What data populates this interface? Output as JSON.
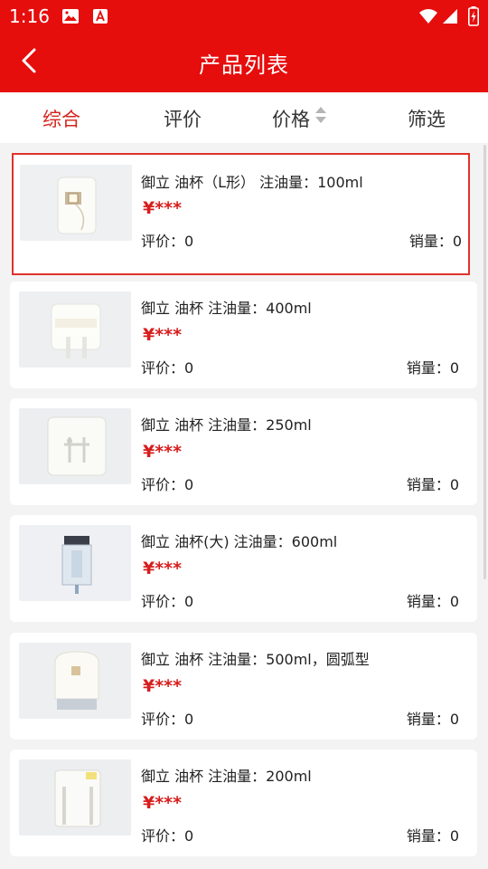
{
  "status_bar": {
    "time": "1:16"
  },
  "header": {
    "title": "产品列表"
  },
  "sort_tabs": [
    "综合",
    "评价",
    "价格",
    "筛选"
  ],
  "products": [
    {
      "name": "御立 油杯（L形） 注油量：100ml",
      "price": "¥***",
      "rating": "评价：0",
      "sales": "销量：0"
    },
    {
      "name": "御立 油杯 注油量：400ml",
      "price": "¥***",
      "rating": "评价：0",
      "sales": "销量：0"
    },
    {
      "name": "御立 油杯 注油量：250ml",
      "price": "¥***",
      "rating": "评价：0",
      "sales": "销量：0"
    },
    {
      "name": "御立 油杯(大) 注油量：600ml",
      "price": "¥***",
      "rating": "评价：0",
      "sales": "销量：0"
    },
    {
      "name": "御立 油杯 注油量：500ml，圆弧型",
      "price": "¥***",
      "rating": "评价：0",
      "sales": "销量：0"
    },
    {
      "name": "御立 油杯 注油量：200ml",
      "price": "¥***",
      "rating": "评价：0",
      "sales": "销量：0"
    }
  ],
  "colors": {
    "header_red": "#e60d0d",
    "active_tab": "#d3241c",
    "price_red": "#d71d1d",
    "highlight_border": "#e0322c"
  }
}
